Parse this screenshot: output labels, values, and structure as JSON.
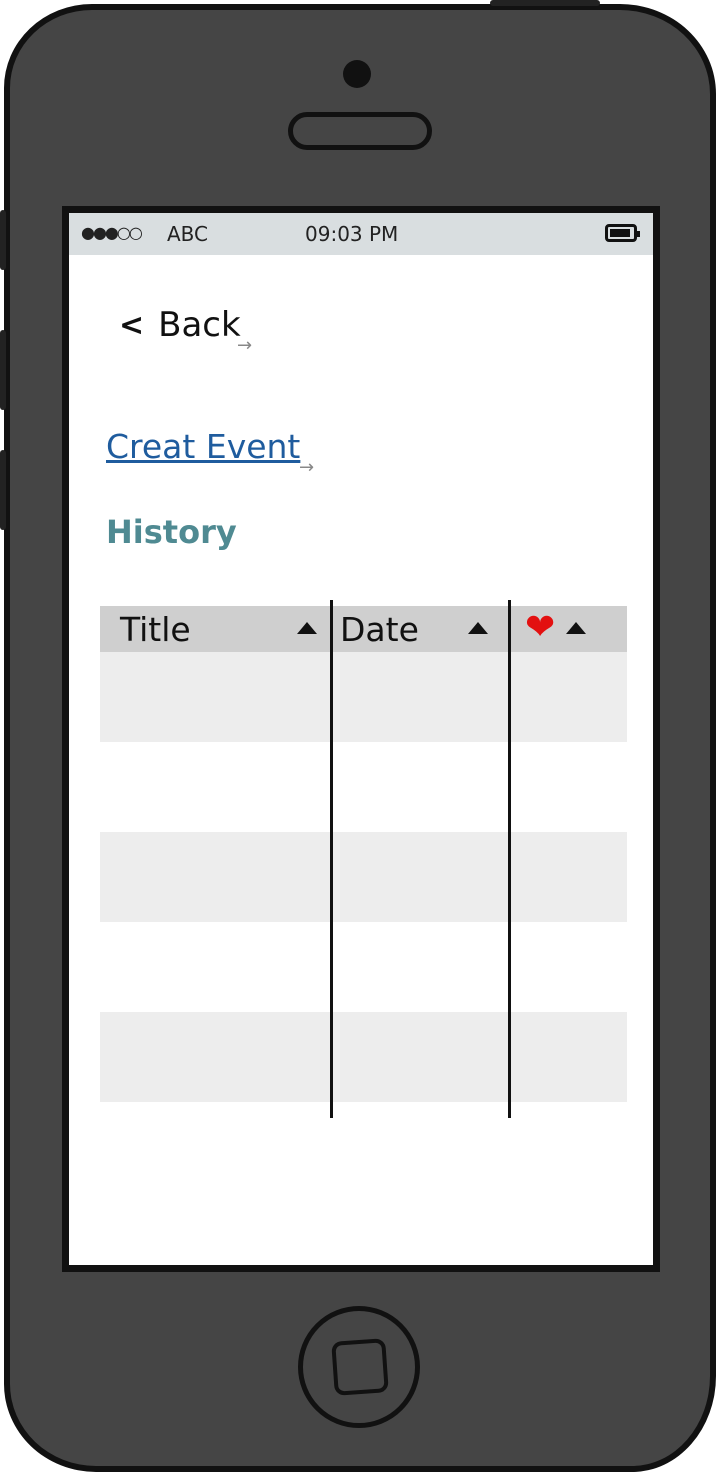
{
  "status_bar": {
    "signal": "●●●○○",
    "carrier": "ABC",
    "time": "09:03 PM",
    "battery_icon": "battery-icon"
  },
  "nav": {
    "back_chevron": "<",
    "back_label": "Back"
  },
  "link_arrow": "→",
  "create_event_label": "Creat Event",
  "history_title": "History",
  "table": {
    "columns": [
      {
        "label": "Title",
        "sort": "ascending"
      },
      {
        "label": "Date",
        "sort": "ascending"
      },
      {
        "label": "",
        "icon": "heart-icon",
        "sort": "ascending"
      }
    ],
    "heart_glyph": "❤",
    "heart_color": "#e31010",
    "rows": [
      {
        "title": "",
        "date": "",
        "fav": ""
      },
      {
        "title": "",
        "date": "",
        "fav": ""
      },
      {
        "title": "",
        "date": "",
        "fav": ""
      },
      {
        "title": "",
        "date": "",
        "fav": ""
      },
      {
        "title": "",
        "date": "",
        "fav": ""
      }
    ]
  },
  "colors": {
    "link": "#1f5c9e",
    "history": "#4f8a92",
    "header_bg": "#cfcfcf",
    "row_shade": "#ededed"
  }
}
